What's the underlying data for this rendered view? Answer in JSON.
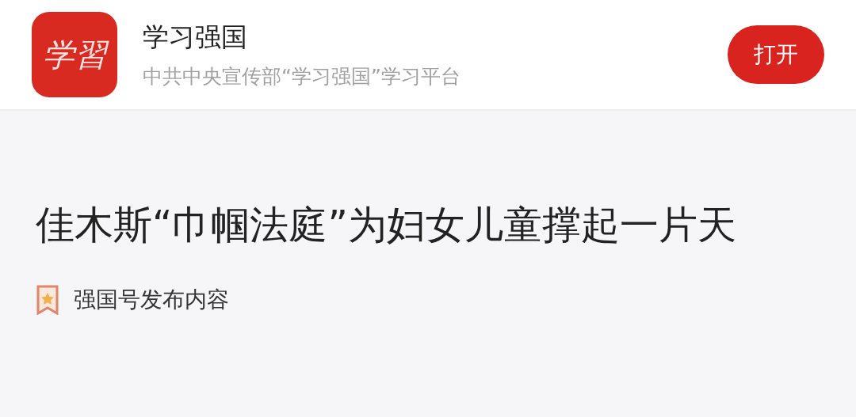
{
  "app_banner": {
    "logo_text": "学習",
    "title": "学习强国",
    "subtitle": "中共中央宣传部“学习强国”学习平台",
    "open_button": "打开"
  },
  "article": {
    "headline": "佳木斯“巾帼法庭”为妇女儿童撑起一片天",
    "source": "强国号发布内容"
  }
}
